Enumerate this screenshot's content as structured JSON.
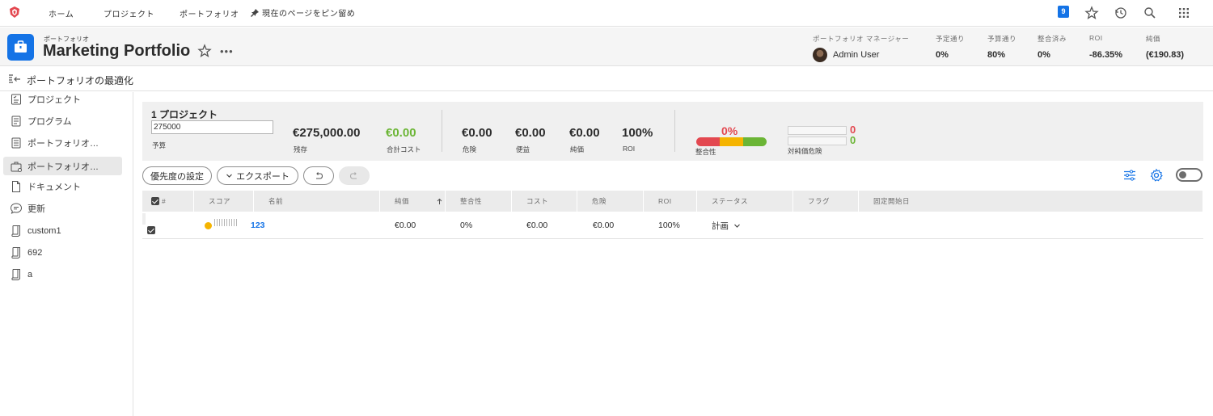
{
  "topnav": {
    "home": "ホーム",
    "projects": "プロジェクト",
    "portfolios": "ポートフォリオ",
    "pin_page": "現在のページをピン留め",
    "notification_count": "9"
  },
  "header": {
    "kicker": "ポートフォリオ",
    "title": "Marketing Portfolio",
    "more": "•••",
    "stats": {
      "manager_label": "ポートフォリオ マネージャー",
      "manager_name": "Admin User",
      "on_time_label": "予定通り",
      "on_time_value": "0%",
      "on_budget_label": "予算通り",
      "on_budget_value": "80%",
      "aligned_label": "整合済み",
      "aligned_value": "0%",
      "roi_label": "ROI",
      "roi_value": "-86.35%",
      "net_label": "純価",
      "net_value": "(€190.83)"
    }
  },
  "subhead": {
    "label": "ポートフォリオの最適化"
  },
  "sidebar": {
    "items": [
      {
        "label": "プロジェクト"
      },
      {
        "label": "プログラム"
      },
      {
        "label": "ポートフォリオ…"
      },
      {
        "label": "ポートフォリオ…"
      },
      {
        "label": "ドキュメント"
      },
      {
        "label": "更新"
      },
      {
        "label": "custom1"
      },
      {
        "label": "692"
      },
      {
        "label": "a"
      }
    ]
  },
  "summary": {
    "title": "1 プロジェクト",
    "budget_value": "275000",
    "budget_label": "予算",
    "remaining_value": "€275,000.00",
    "remaining_label": "残存",
    "total_cost_value": "€0.00",
    "total_cost_label": "合計コスト",
    "risk_value": "€0.00",
    "risk_label": "危険",
    "benefit_value": "€0.00",
    "benefit_label": "便益",
    "net_value": "€0.00",
    "net_label": "純価",
    "roi_value": "100%",
    "roi_label": "ROI",
    "alignment_value": "0%",
    "alignment_label": "整合性",
    "risk_net_label": "対純価危険",
    "risk_net_values": [
      "0",
      "0"
    ],
    "colors": {
      "red": "#e34850",
      "orange": "#f5b400",
      "green": "#6bb535"
    }
  },
  "toolbar": {
    "priority": "優先度の設定",
    "export": "エクスポート"
  },
  "table": {
    "headers": [
      "#",
      "スコア",
      "名前",
      "純価",
      "整合性",
      "コスト",
      "危険",
      "ROI",
      "ステータス",
      "フラグ",
      "固定開始日"
    ],
    "rows": [
      {
        "name": "123",
        "net": "€0.00",
        "alignment": "0%",
        "cost": "€0.00",
        "risk": "€0.00",
        "roi": "100%",
        "status": "計画"
      }
    ]
  }
}
